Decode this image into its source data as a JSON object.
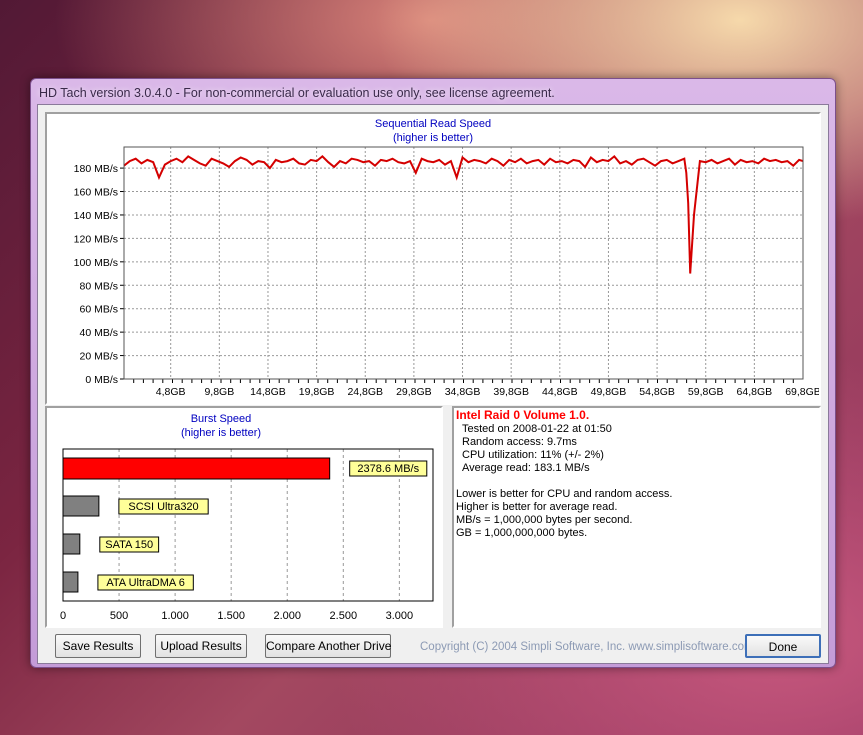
{
  "window": {
    "title": "HD Tach version 3.0.4.0  - For non-commercial or evaluation use only, see license agreement."
  },
  "sequential": {
    "title": "Sequential Read Speed",
    "subtitle": "(higher is better)",
    "series_color": "#d40000"
  },
  "burst": {
    "title": "Burst Speed",
    "subtitle": "(higher is better)"
  },
  "info": {
    "drive_name": "Intel Raid 0 Volume 1.0.",
    "tested_on": "Tested on 2008-01-22 at 01:50",
    "random_access": "Random access: 9.7ms",
    "cpu_utilization": "CPU utilization: 11% (+/- 2%)",
    "average_read": "Average read: 183.1 MB/s",
    "notes": [
      "Lower is better for CPU and random access.",
      "Higher is better for average read.",
      "MB/s = 1,000,000 bytes per second.",
      "GB = 1,000,000,000 bytes."
    ]
  },
  "buttons": {
    "save": "Save Results",
    "upload": "Upload Results",
    "compare": "Compare Another Drive",
    "done": "Done"
  },
  "copyright": "Copyright (C) 2004 Simpli Software, Inc. www.simplisoftware.com",
  "chart_data": [
    {
      "type": "line",
      "title": "Sequential Read Speed",
      "subtitle": "(higher is better)",
      "xlabel": "",
      "ylabel": "",
      "y_ticks": [
        "0 MB/s",
        "20 MB/s",
        "40 MB/s",
        "60 MB/s",
        "80 MB/s",
        "100 MB/s",
        "120 MB/s",
        "140 MB/s",
        "160 MB/s",
        "180 MB/s"
      ],
      "x_ticks": [
        "4,8GB",
        "9,8GB",
        "14,8GB",
        "19,8GB",
        "24,8GB",
        "29,8GB",
        "34,8GB",
        "39,8GB",
        "44,8GB",
        "49,8GB",
        "54,8GB",
        "59,8GB",
        "64,8GB",
        "69,8GB"
      ],
      "ylim": [
        0,
        198
      ],
      "xlim": [
        0,
        69.8
      ],
      "grid": true,
      "color": "#d40000",
      "series": [
        {
          "x": [
            0,
            0.6,
            1.2,
            1.8,
            2.4,
            3.0,
            3.6,
            4.2,
            4.8,
            5.4,
            6.0,
            6.6,
            7.2,
            7.8,
            8.4,
            9.0,
            9.6,
            10.2,
            10.8,
            11.4,
            12.0,
            12.6,
            13.2,
            13.8,
            14.4,
            15.0,
            15.6,
            16.2,
            16.8,
            17.4,
            18.0,
            18.6,
            19.2,
            19.8,
            20.4,
            21.0,
            21.6,
            22.2,
            22.8,
            23.4,
            24.0,
            24.6,
            25.2,
            25.8,
            26.4,
            27.0,
            27.6,
            28.2,
            28.8,
            29.4,
            30.0,
            30.6,
            31.2,
            31.8,
            32.4,
            33.0,
            33.6,
            34.2,
            34.8,
            35.4,
            36.0,
            36.6,
            37.2,
            37.8,
            38.4,
            39.0,
            39.6,
            40.2,
            40.8,
            41.4,
            42.0,
            42.6,
            43.2,
            43.8,
            44.4,
            45.0,
            45.6,
            46.2,
            46.8,
            47.4,
            48.0,
            48.6,
            49.2,
            49.8,
            50.4,
            51.0,
            51.6,
            52.2,
            52.8,
            53.4,
            54.0,
            54.6,
            55.2,
            55.8,
            56.4,
            57.0,
            57.6,
            57.8,
            58.0,
            58.2,
            58.6,
            59.2,
            59.8,
            60.4,
            61.0,
            61.6,
            62.2,
            62.8,
            63.4,
            64.0,
            64.6,
            65.2,
            65.8,
            66.4,
            67.0,
            67.6,
            68.2,
            68.8,
            69.4,
            69.8
          ],
          "y": [
            182,
            186,
            188,
            184,
            187,
            185,
            172,
            183,
            186,
            188,
            185,
            190,
            187,
            184,
            182,
            188,
            186,
            184,
            181,
            186,
            189,
            187,
            183,
            186,
            185,
            180,
            187,
            185,
            186,
            188,
            184,
            183,
            187,
            186,
            190,
            185,
            181,
            186,
            184,
            188,
            187,
            185,
            186,
            182,
            187,
            186,
            188,
            185,
            184,
            186,
            176,
            188,
            186,
            185,
            187,
            183,
            186,
            172,
            189,
            185,
            187,
            186,
            184,
            188,
            186,
            182,
            187,
            185,
            188,
            184,
            186,
            187,
            183,
            188,
            185,
            186,
            184,
            187,
            186,
            181,
            189,
            185,
            187,
            186,
            190,
            184,
            186,
            183,
            187,
            188,
            185,
            182,
            186,
            187,
            184,
            186,
            188,
            176,
            150,
            90,
            140,
            186,
            185,
            187,
            184,
            186,
            188,
            183,
            187,
            185,
            186,
            184,
            188,
            186,
            187,
            185,
            186,
            182,
            187,
            186
          ]
        }
      ]
    },
    {
      "type": "bar",
      "title": "Burst Speed",
      "subtitle": "(higher is better)",
      "orientation": "horizontal",
      "categories": [
        "2378.6 MB/s",
        "SCSI Ultra320",
        "SATA 150",
        "ATA UltraDMA 6"
      ],
      "values": [
        2378.6,
        320,
        150,
        133
      ],
      "colors": [
        "#ff0000",
        "#808080",
        "#808080",
        "#808080"
      ],
      "x_ticks": [
        "0",
        "500",
        "1.000",
        "1.500",
        "2.000",
        "2.500",
        "3.000"
      ],
      "xlim": [
        0,
        3300
      ],
      "grid": true
    }
  ]
}
